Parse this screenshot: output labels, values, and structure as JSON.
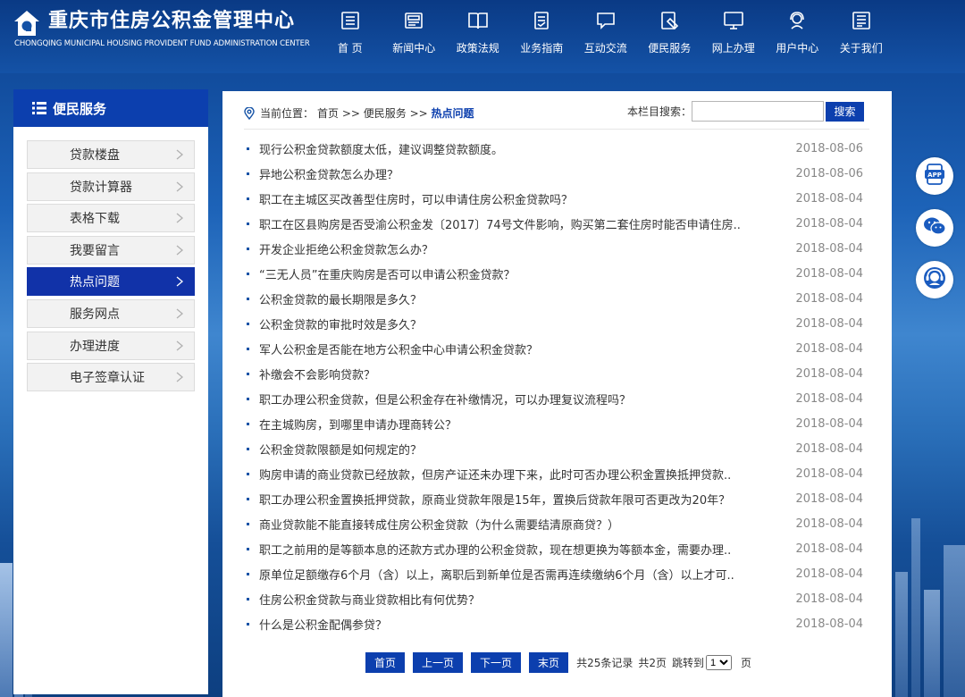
{
  "header": {
    "title_cn": "重庆市住房公积金管理中心",
    "title_en": "CHONGQING MUNICIPAL HOUSING PROVIDENT FUND ADMINISTRATION CENTER",
    "nav": [
      {
        "label": "首  页",
        "icon": "home-doc-icon"
      },
      {
        "label": "新闻中心",
        "icon": "news-icon"
      },
      {
        "label": "政策法规",
        "icon": "book-icon"
      },
      {
        "label": "业务指南",
        "icon": "guide-icon"
      },
      {
        "label": "互动交流",
        "icon": "chat-icon"
      },
      {
        "label": "便民服务",
        "icon": "service-icon"
      },
      {
        "label": "网上办理",
        "icon": "monitor-icon"
      },
      {
        "label": "用户中心",
        "icon": "user-headset-icon"
      },
      {
        "label": "关于我们",
        "icon": "about-icon"
      }
    ]
  },
  "sidebar": {
    "title": "便民服务",
    "items": [
      {
        "label": "贷款楼盘",
        "active": false
      },
      {
        "label": "贷款计算器",
        "active": false
      },
      {
        "label": "表格下载",
        "active": false
      },
      {
        "label": "我要留言",
        "active": false
      },
      {
        "label": "热点问题",
        "active": true
      },
      {
        "label": "服务网点",
        "active": false
      },
      {
        "label": "办理进度",
        "active": false
      },
      {
        "label": "电子签章认证",
        "active": false
      }
    ]
  },
  "breadcrumb": {
    "prefix": "当前位置：",
    "home": "首页",
    "sep1": " >> ",
    "section": "便民服务",
    "sep2": " >> ",
    "current": "热点问题"
  },
  "search": {
    "label": "本栏目搜索：",
    "value": "",
    "button": "搜索"
  },
  "news": [
    {
      "title": "现行公积金贷款额度太低，建议调整贷款额度。",
      "date": "2018-08-06"
    },
    {
      "title": "异地公积金贷款怎么办理？",
      "date": "2018-08-06"
    },
    {
      "title": "职工在主城区买改善型住房时，可以申请住房公积金贷款吗？",
      "date": "2018-08-04"
    },
    {
      "title": "职工在区县购房是否受渝公积金发〔2017〕74号文件影响，购买第二套住房时能否申请住房..",
      "date": "2018-08-04"
    },
    {
      "title": "开发企业拒绝公积金贷款怎么办？",
      "date": "2018-08-04"
    },
    {
      "title": "“三无人员”在重庆购房是否可以申请公积金贷款？",
      "date": "2018-08-04"
    },
    {
      "title": "公积金贷款的最长期限是多久？",
      "date": "2018-08-04"
    },
    {
      "title": "公积金贷款的审批时效是多久？",
      "date": "2018-08-04"
    },
    {
      "title": "军人公积金是否能在地方公积金中心申请公积金贷款？",
      "date": "2018-08-04"
    },
    {
      "title": "补缴会不会影响贷款？",
      "date": "2018-08-04"
    },
    {
      "title": "职工办理公积金贷款，但是公积金存在补缴情况，可以办理复议流程吗？",
      "date": "2018-08-04"
    },
    {
      "title": "在主城购房，到哪里申请办理商转公？",
      "date": "2018-08-04"
    },
    {
      "title": "公积金贷款限额是如何规定的？",
      "date": "2018-08-04"
    },
    {
      "title": "购房申请的商业贷款已经放款，但房产证还未办理下来，此时可否办理公积金置换抵押贷款..",
      "date": "2018-08-04"
    },
    {
      "title": "职工办理公积金置换抵押贷款，原商业贷款年限是15年，置换后贷款年限可否更改为20年？",
      "date": "2018-08-04"
    },
    {
      "title": "商业贷款能不能直接转成住房公积金贷款（为什么需要结清原商贷？）",
      "date": "2018-08-04"
    },
    {
      "title": "职工之前用的是等额本息的还款方式办理的公积金贷款，现在想更换为等额本金，需要办理..",
      "date": "2018-08-04"
    },
    {
      "title": "原单位足额缴存6个月（含）以上，离职后到新单位是否需再连续缴纳6个月（含）以上才可..",
      "date": "2018-08-04"
    },
    {
      "title": "住房公积金贷款与商业贷款相比有何优势？",
      "date": "2018-08-04"
    },
    {
      "title": "什么是公积金配偶参贷？",
      "date": "2018-08-04"
    }
  ],
  "pager": {
    "first": "首页",
    "prev": "上一页",
    "next": "下一页",
    "last": "末页",
    "total": "共25条记录",
    "pages": "共2页",
    "jump": "跳转到",
    "page_value": "1",
    "page_unit": "页"
  },
  "floating": [
    {
      "name": "app",
      "icon": "app-icon"
    },
    {
      "name": "wechat",
      "icon": "wechat-icon"
    },
    {
      "name": "support",
      "icon": "customer-service-icon"
    }
  ],
  "colors": {
    "brand": "#0c3fae",
    "header": "#0a3a85",
    "active_item": "#1132a8"
  }
}
